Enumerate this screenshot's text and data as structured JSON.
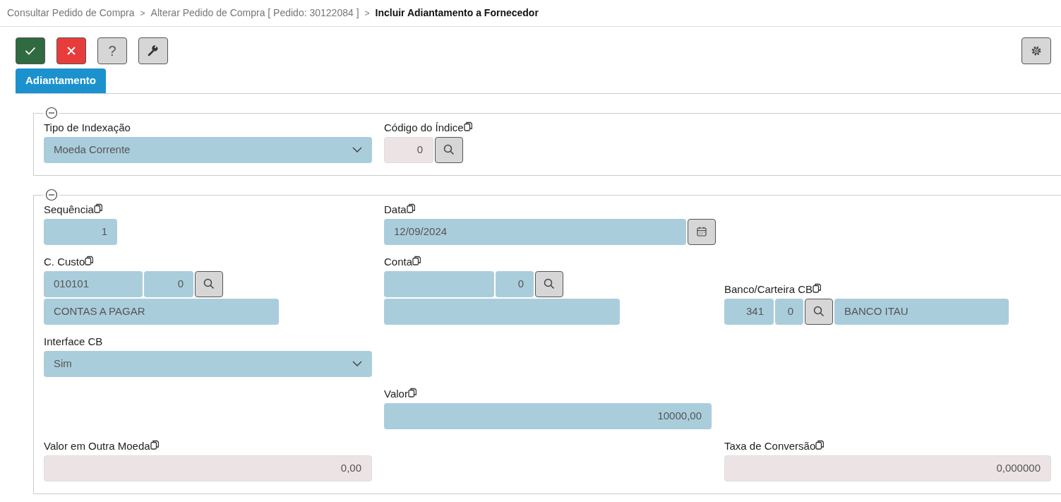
{
  "breadcrumb": {
    "items": [
      {
        "label": "Consultar Pedido de Compra",
        "current": false
      },
      {
        "label": "Alterar Pedido de Compra [ Pedido: 30122084 ]",
        "current": false
      },
      {
        "label": "Incluir Adiantamento a Fornecedor",
        "current": true
      }
    ],
    "separators": [
      ">",
      ">"
    ]
  },
  "toolbar": [
    {
      "kind": "confirm"
    },
    {
      "kind": "cancel"
    },
    {
      "kind": "help",
      "label": "?"
    },
    {
      "kind": "tools"
    }
  ],
  "settings_button": true,
  "tabs": [
    {
      "label": "Adiantamento",
      "selected": true
    }
  ],
  "sections": [
    {
      "expanded": true,
      "fields": [
        {
          "kind": "select",
          "label": "Tipo de Indexação",
          "copy_icon": false,
          "disabled": false,
          "value": "Moeda Corrente"
        },
        {
          "kind": "lookup",
          "label": "Código do Índice",
          "copy_icon": true,
          "disabled": true,
          "sub": "0"
        }
      ]
    },
    {
      "expanded": true,
      "fields": [
        {
          "kind": "text",
          "label": "Sequência",
          "copy_icon": true,
          "disabled": false,
          "value": "1"
        },
        {
          "kind": "date",
          "label": "Data",
          "copy_icon": true,
          "disabled": false,
          "value": "12/09/2024"
        },
        {
          "kind": "lookup",
          "label": "C. Custo",
          "copy_icon": true,
          "disabled": false,
          "code": "010101",
          "sub": "0",
          "description": "CONTAS A PAGAR"
        },
        {
          "kind": "lookup",
          "label": "Conta",
          "copy_icon": true,
          "disabled": false,
          "sub": "0"
        },
        {
          "kind": "lookup",
          "label": "Banco/Carteira CB",
          "copy_icon": true,
          "disabled": false,
          "code": "341",
          "sub": "0",
          "description": "BANCO ITAU"
        },
        {
          "kind": "select",
          "label": "Interface CB",
          "copy_icon": false,
          "disabled": false,
          "value": "Sim"
        },
        {
          "kind": "text",
          "label": "Valor",
          "copy_icon": true,
          "disabled": false,
          "value": "10000,00"
        },
        {
          "kind": "text",
          "label": "Valor em Outra Moeda",
          "copy_icon": true,
          "disabled": true,
          "value": "0,00"
        },
        {
          "kind": "text",
          "label": "Taxa de Conversão",
          "copy_icon": true,
          "disabled": true,
          "value": "0,000000"
        }
      ]
    }
  ]
}
